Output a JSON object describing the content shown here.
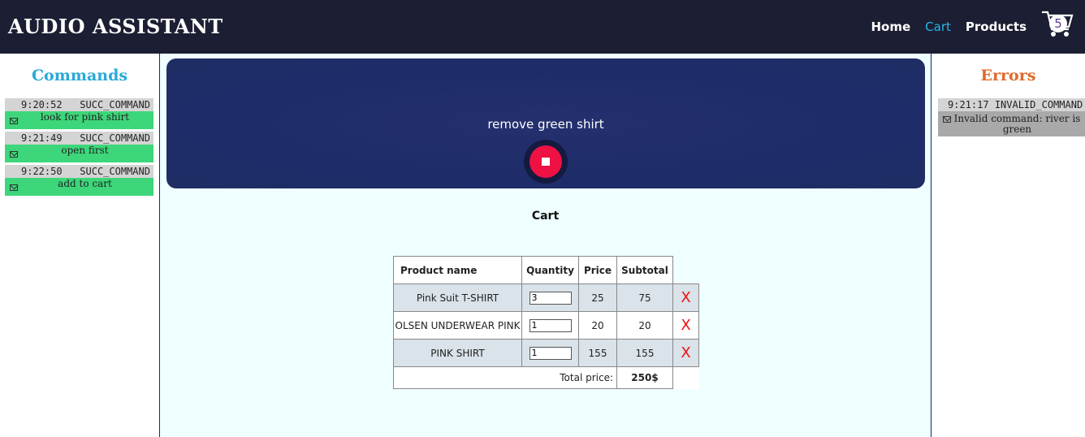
{
  "header": {
    "brand": "AUDIO ASSISTANT",
    "nav": [
      "Home",
      "Cart",
      "Products"
    ],
    "active_nav": "Cart",
    "cart_count": "5"
  },
  "commands": {
    "title": "Commands",
    "items": [
      {
        "time": "9:20:52",
        "type": "SUCC_COMMAND",
        "text": "look for pink shirt"
      },
      {
        "time": "9:21:49",
        "type": "SUCC_COMMAND",
        "text": "open first"
      },
      {
        "time": "9:22:50",
        "type": "SUCC_COMMAND",
        "text": "add to cart"
      }
    ]
  },
  "errors": {
    "title": "Errors",
    "items": [
      {
        "time": "9:21:17",
        "type": "INVALID_COMMAND",
        "text": "Invalid command: river is green"
      }
    ]
  },
  "voice": {
    "transcript": "remove green shirt"
  },
  "cart": {
    "title": "Cart",
    "columns": [
      "Product name",
      "Quantity",
      "Price",
      "Subtotal"
    ],
    "rows": [
      {
        "name": "Pink Suit T-SHIRT",
        "qty": "3",
        "price": "25",
        "subtotal": "75",
        "remove": "X"
      },
      {
        "name": "OLSEN UNDERWEAR PINK",
        "qty": "1",
        "price": "20",
        "subtotal": "20",
        "remove": "X"
      },
      {
        "name": "PINK SHIRT",
        "qty": "1",
        "price": "155",
        "subtotal": "155",
        "remove": "X"
      }
    ],
    "total_label": "Total price:",
    "total_value": "250$"
  },
  "colors": {
    "header_bg": "#1c1f33",
    "accent": "#29b6e6",
    "success": "#3dd67a",
    "error_title": "#e06a2b",
    "stop": "#ee1144"
  }
}
